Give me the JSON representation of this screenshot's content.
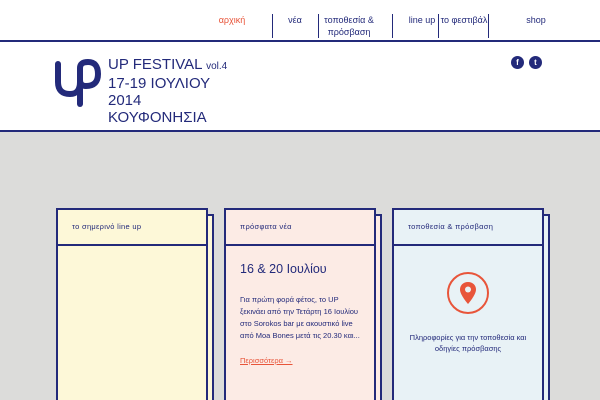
{
  "nav": {
    "items": [
      {
        "label": "αρχική",
        "active": true
      },
      {
        "label": "νέα",
        "active": false
      },
      {
        "label": "τοποθεσία & πρόσβαση",
        "active": false
      },
      {
        "label": "line up",
        "active": false
      },
      {
        "label": "το φεστιβάλ",
        "active": false
      },
      {
        "label": "shop",
        "active": false
      }
    ]
  },
  "header": {
    "title": "UP FESTIVAL",
    "vol": "vol.4",
    "dates": "17-19 ΙΟΥΛΙΟΥ",
    "year": "2014",
    "location": "ΚΟΥΦΟΝΗΣΙΑ",
    "social": [
      {
        "icon": "facebook-icon",
        "glyph": "f"
      },
      {
        "icon": "twitter-icon",
        "glyph": "t"
      }
    ]
  },
  "cards": {
    "lineup": {
      "title": "το σημερινό line up"
    },
    "news": {
      "title": "πρόσφατα νέα",
      "headline": "16 & 20 Ιουλίου",
      "text": "Για πρώτη φορά φέτος, το UP ξεκινάει από την Τετάρτη 16 Ιουλίου στο Sorokos bar με ακουστικό live από Moa Bones μετά τις 20.30 και...",
      "more": "Περισσότερα →"
    },
    "location": {
      "title": "τοποθεσία & πρόσβαση",
      "text": "Πληροφορίες για την τοποθεσία και οδηγίες πρόσβασης"
    }
  },
  "colors": {
    "navy": "#232a7a",
    "accent": "#e8553a",
    "yellow": "#fdf8d8",
    "pink": "#fcebe5",
    "blue": "#e8f2f6"
  }
}
